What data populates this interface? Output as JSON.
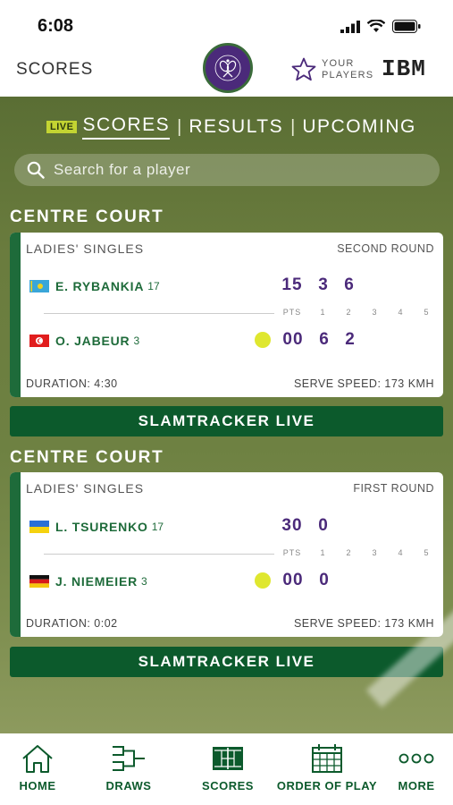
{
  "status_bar": {
    "time": "6:08"
  },
  "header": {
    "title": "SCORES",
    "your_players_line1": "YOUR",
    "your_players_line2": "PLAYERS",
    "sponsor": "IBM"
  },
  "tabs": {
    "live_badge": "LIVE",
    "items": [
      {
        "label": "SCORES",
        "active": true
      },
      {
        "label": "RESULTS",
        "active": false
      },
      {
        "label": "UPCOMING",
        "active": false
      }
    ]
  },
  "search": {
    "placeholder": "Search for a player"
  },
  "matches": [
    {
      "court": "CENTRE COURT",
      "event": "LADIES' SINGLES",
      "round": "SECOND ROUND",
      "players": [
        {
          "name": "E. RYBANKIA",
          "seed": "17",
          "country": "Kazakhstan",
          "points": "15",
          "sets": [
            "3",
            "6"
          ],
          "serving": false
        },
        {
          "name": "O. JABEUR",
          "seed": "3",
          "country": "Tunisia",
          "points": "00",
          "sets": [
            "6",
            "2"
          ],
          "serving": true
        }
      ],
      "columns": [
        "PTS",
        "1",
        "2",
        "3",
        "4",
        "5"
      ],
      "duration": "DURATION: 4:30",
      "serve_speed": "SERVE SPEED: 173 KMH",
      "button": "SLAMTRACKER LIVE"
    },
    {
      "court": "CENTRE COURT",
      "event": "LADIES' SINGLES",
      "round": "FIRST ROUND",
      "players": [
        {
          "name": "L. TSURENKO",
          "seed": "17",
          "country": "Ukraine",
          "points": "30",
          "sets": [
            "0"
          ],
          "serving": false
        },
        {
          "name": "J. NIEMEIER",
          "seed": "3",
          "country": "Germany",
          "points": "00",
          "sets": [
            "0"
          ],
          "serving": true
        }
      ],
      "columns": [
        "PTS",
        "1",
        "2",
        "3",
        "4",
        "5"
      ],
      "duration": "DURATION: 0:02",
      "serve_speed": "SERVE SPEED: 173 KMH",
      "button": "SLAMTRACKER LIVE"
    }
  ],
  "bottom_nav": [
    {
      "label": "HOME",
      "icon": "home-icon"
    },
    {
      "label": "DRAWS",
      "icon": "draws-icon"
    },
    {
      "label": "SCORES",
      "icon": "scores-court-icon"
    },
    {
      "label": "ORDER OF PLAY",
      "icon": "calendar-icon"
    },
    {
      "label": "MORE",
      "icon": "more-dots-icon"
    }
  ],
  "colors": {
    "brand_green": "#0c5a2c",
    "brand_purple": "#4b2a7a",
    "live_badge": "#c3d432",
    "serve_ball": "#dfe72f"
  }
}
